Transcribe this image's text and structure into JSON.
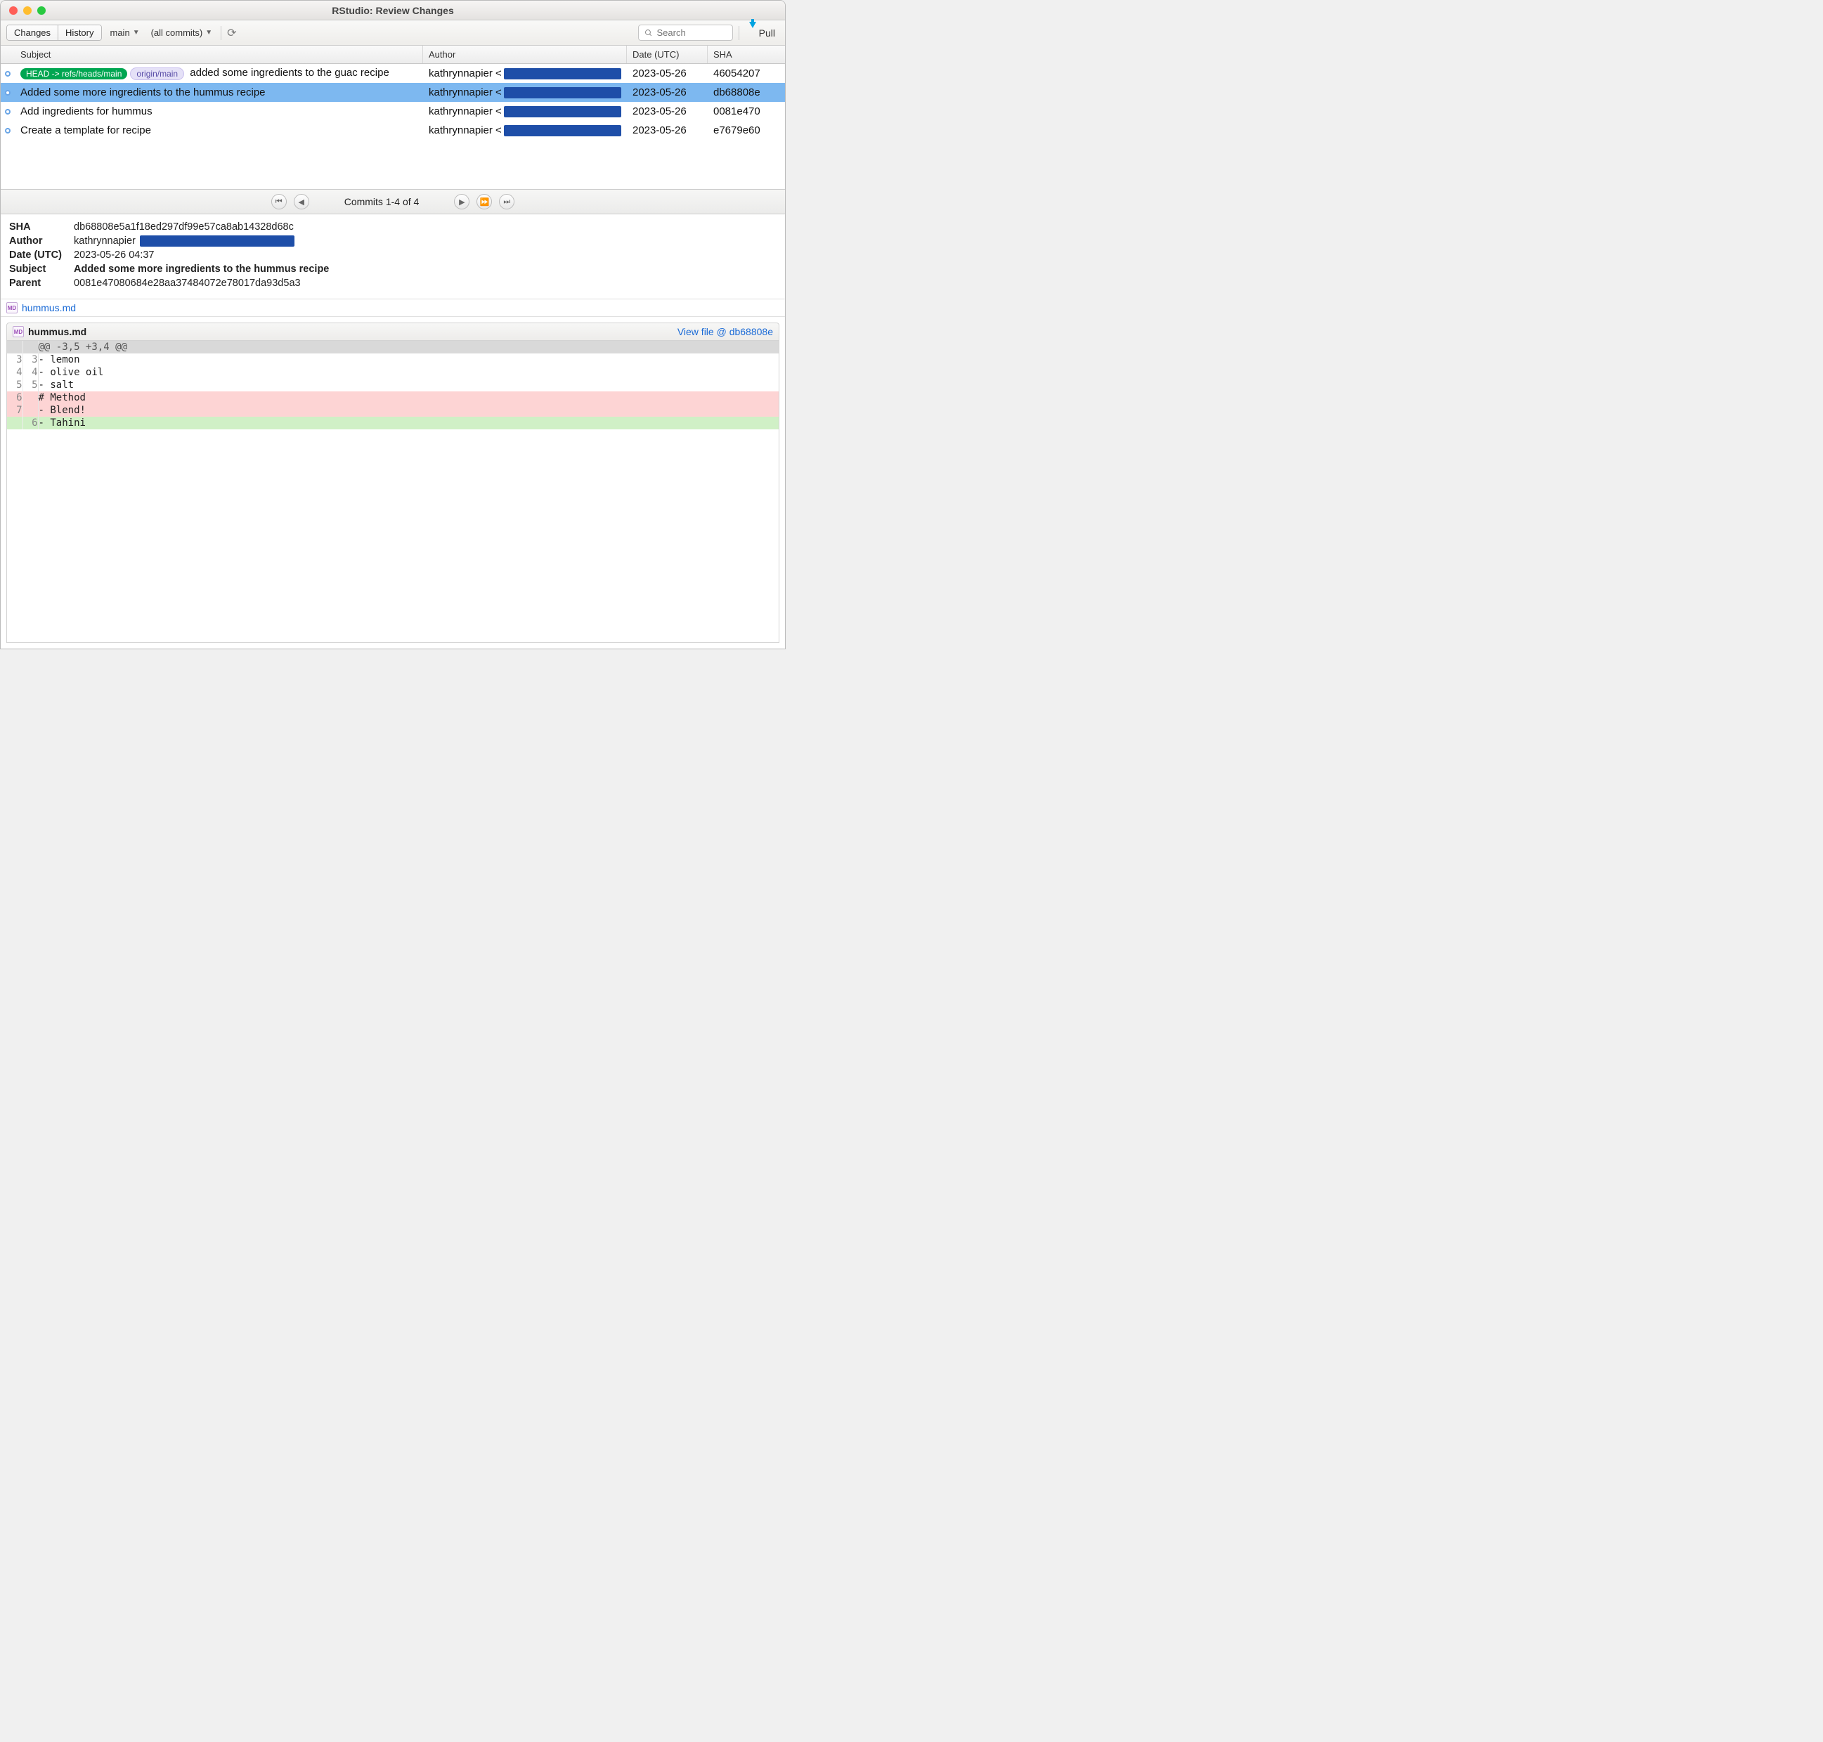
{
  "title": "RStudio: Review Changes",
  "tabs": {
    "changes": "Changes",
    "history": "History"
  },
  "branch_selector": "main",
  "scope_selector": "(all commits)",
  "search": {
    "placeholder": "Search"
  },
  "pull_label": "Pull",
  "columns": {
    "subject": "Subject",
    "author": "Author",
    "date": "Date (UTC)",
    "sha": "SHA"
  },
  "commits": [
    {
      "badges": [
        {
          "kind": "head",
          "text": "HEAD -> refs/heads/main"
        },
        {
          "kind": "remote",
          "text": "origin/main"
        }
      ],
      "subject": "added some ingredients to the guac recipe",
      "author": "kathrynnapier",
      "date": "2023-05-26",
      "sha": "46054207",
      "selected": false
    },
    {
      "badges": [],
      "subject": "Added some more ingredients to the hummus recipe",
      "author": "kathrynnapier",
      "date": "2023-05-26",
      "sha": "db68808e",
      "selected": true
    },
    {
      "badges": [],
      "subject": "Add ingredients for hummus",
      "author": "kathrynnapier",
      "date": "2023-05-26",
      "sha": "0081e470",
      "selected": false
    },
    {
      "badges": [],
      "subject": "Create a template for recipe",
      "author": "kathrynnapier",
      "date": "2023-05-26",
      "sha": "e7679e60",
      "selected": false
    }
  ],
  "pager_text": "Commits 1-4 of 4",
  "details": {
    "labels": {
      "sha": "SHA",
      "author": "Author",
      "date": "Date (UTC)",
      "subject": "Subject",
      "parent": "Parent"
    },
    "sha": "db68808e5a1f18ed297df99e57ca8ab14328d68c",
    "author": "kathrynnapier",
    "date": "2023-05-26 04:37",
    "subject": "Added some more ingredients to the hummus recipe",
    "parent": "0081e47080684e28aa37484072e78017da93d5a3"
  },
  "changed_file": "hummus.md",
  "diff": {
    "filename": "hummus.md",
    "view_link": "View file @ db68808e",
    "hunk": "@@ -3,5 +3,4 @@",
    "lines": [
      {
        "type": "ctx",
        "old": "3",
        "new": "3",
        "text": "- lemon"
      },
      {
        "type": "ctx",
        "old": "4",
        "new": "4",
        "text": "- olive oil"
      },
      {
        "type": "ctx",
        "old": "5",
        "new": "5",
        "text": "- salt"
      },
      {
        "type": "del",
        "old": "6",
        "new": "",
        "text": "# Method"
      },
      {
        "type": "del",
        "old": "7",
        "new": "",
        "text": "- Blend!"
      },
      {
        "type": "add",
        "old": "",
        "new": "6",
        "text": "- Tahini"
      }
    ]
  }
}
